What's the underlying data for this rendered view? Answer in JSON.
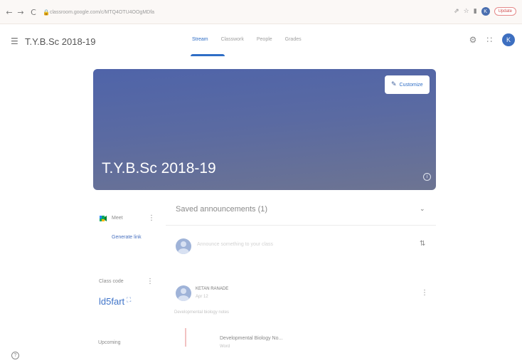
{
  "browser": {
    "back_icon": "←",
    "forward_icon": "→",
    "reload_icon": "C",
    "lock_icon": "lock-icon",
    "url": "classroom.google.com/c/MTQ4OTU4OOgMDfa",
    "icons": [
      "share-icon",
      "star-icon",
      "window-icon"
    ],
    "avatar_letter": "K",
    "update_label": "Update"
  },
  "header": {
    "class_title": "T.Y.B.Sc 2018-19",
    "tabs": [
      {
        "label": "Stream",
        "active": true
      },
      {
        "label": "Classwork",
        "active": false
      },
      {
        "label": "People",
        "active": false
      },
      {
        "label": "Grades",
        "active": false
      }
    ],
    "avatar_letter": "K"
  },
  "banner": {
    "title": "T.Y.B.Sc 2018-19",
    "customize_label": "Customize",
    "info_icon": "i",
    "color": "#5a6aa2"
  },
  "meet": {
    "label": "Meet",
    "generate_link": "Generate link"
  },
  "class_code": {
    "label": "Class code",
    "value": "ld5fart"
  },
  "upcoming": {
    "label": "Upcoming"
  },
  "stream": {
    "saved_announcements": "Saved announcements (1)",
    "share_placeholder": "Announce something to your class",
    "post": {
      "author": "KETAN RANADE",
      "date": "Apr 12",
      "text": "Developmental biology notes",
      "attachment_title": "Developmental Biology No...",
      "attachment_type": "Word"
    }
  },
  "colors": {
    "accent": "#2f6ec6",
    "banner": "#5a6aa2"
  }
}
